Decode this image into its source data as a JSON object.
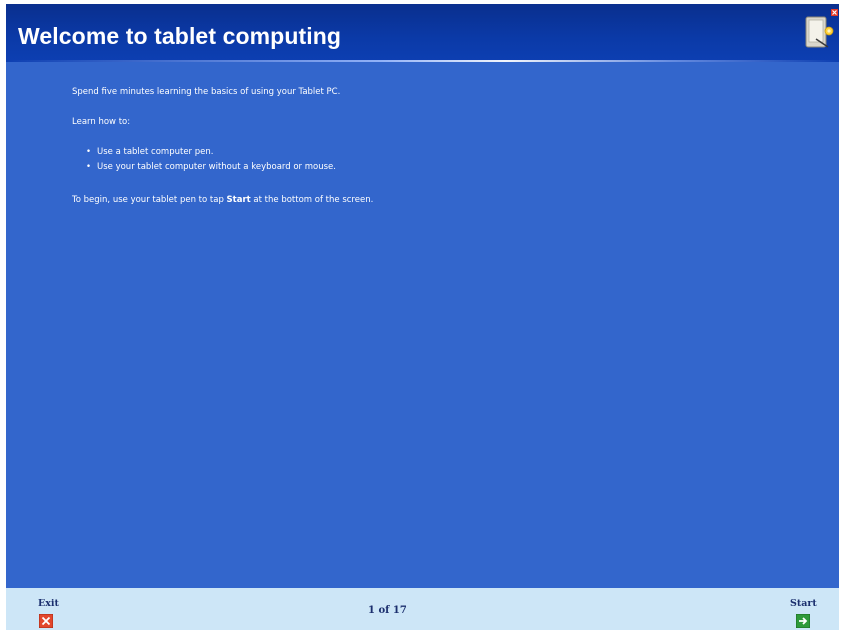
{
  "header": {
    "title": "Welcome to tablet computing",
    "icon": "tablet-pc-icon"
  },
  "content": {
    "intro": "Spend five minutes learning the basics of using your Tablet PC.",
    "learn_heading": "Learn how to:",
    "bullets": [
      "Use a tablet computer pen.",
      "Use your tablet computer without a keyboard or mouse."
    ],
    "begin_prefix": "To begin, use your tablet pen to tap ",
    "begin_bold": "Start",
    "begin_suffix": " at the bottom of the screen."
  },
  "footer": {
    "exit_label": "Exit",
    "exit_icon": "close-x-icon",
    "page_indicator": "1 of 17",
    "start_label": "Start",
    "start_icon": "arrow-right-icon"
  },
  "colors": {
    "body_blue": "#3366cc",
    "header_blue": "#0b3aa8",
    "footer_bg": "#cde6f7",
    "exit_red": "#e2472c",
    "start_green": "#2f9a3a"
  }
}
